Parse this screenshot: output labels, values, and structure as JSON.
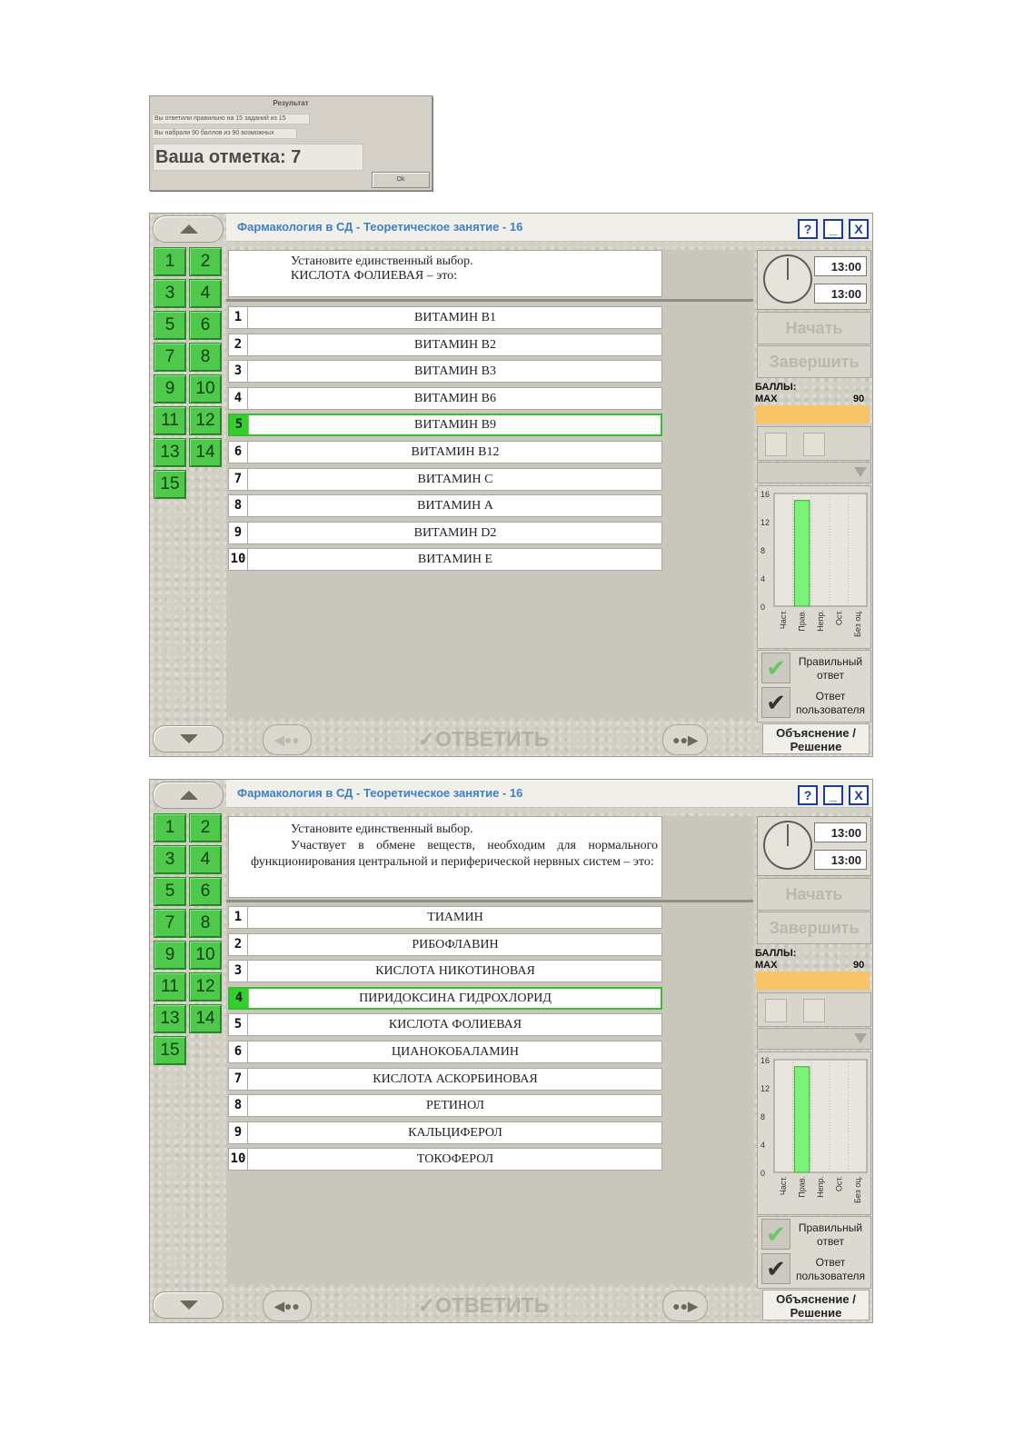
{
  "result": {
    "title": "Результат",
    "line1": "Вы ответили правильно на 15 заданий из 15",
    "line2": "Вы набрали 90 баллов из 90 возможных",
    "grade": "Ваша отметка: 7",
    "ok": "Ok"
  },
  "common": {
    "title": "Фармакология в СД - Теоретическое занятие - 16",
    "help": "?",
    "minimize": "_",
    "close": "X",
    "numbers": [
      "1",
      "2",
      "3",
      "4",
      "5",
      "6",
      "7",
      "8",
      "9",
      "10",
      "11",
      "12",
      "13",
      "14",
      "15"
    ],
    "time_total": "13:00",
    "time_left": "13:00",
    "start": "Начать",
    "finish": "Завершить",
    "score_label": "БАЛЛЫ:",
    "max_label": "MAX",
    "max_value": "90",
    "answer": "✓ОТВЕТИТЬ",
    "explanation": "Объяснение / Решение",
    "correct_answer": "Правильный ответ",
    "user_answer": "Ответ пользователя",
    "prev": "◀●●",
    "next": "●●▶",
    "icon_up": "up-arrow-icon",
    "icon_down": "down-arrow-icon",
    "icon_check": "check-icon"
  },
  "chart_data": {
    "type": "bar",
    "categories": [
      "Част.",
      "Прав.",
      "Непр.",
      "Ост.",
      "Без оц."
    ],
    "values": [
      0,
      15,
      0,
      0,
      0
    ],
    "yticks": [
      "16",
      "12",
      "8",
      "4",
      "0"
    ],
    "ylim": [
      0,
      16
    ],
    "color": "#7df27a"
  },
  "q1": {
    "instruction": "Установите единственный выбор.",
    "text": "КИСЛОТА ФОЛИЕВАЯ – это:",
    "selected": 5,
    "answers": [
      "ВИТАМИН В1",
      "ВИТАМИН В2",
      "ВИТАМИН В3",
      "ВИТАМИН В6",
      "ВИТАМИН В9",
      "ВИТАМИН В12",
      "ВИТАМИН С",
      "ВИТАМИН А",
      "ВИТАМИН D2",
      "ВИТАМИН Е"
    ]
  },
  "q2": {
    "instruction": "Установите единственный выбор.",
    "text": "Участвует в обмене веществ, необходим для нормального функционирования центральной и периферической нервных систем – это:",
    "selected": 4,
    "answers": [
      "ТИАМИН",
      "РИБОФЛАВИН",
      "КИСЛОТА НИКОТИНОВАЯ",
      "ПИРИДОКСИНА ГИДРОХЛОРИД",
      "КИСЛОТА ФОЛИЕВАЯ",
      "ЦИАНОКОБАЛАМИН",
      "КИСЛОТА АСКОРБИНОВАЯ",
      "РЕТИНОЛ",
      "КАЛЬЦИФЕРОЛ",
      "ТОКОФЕРОЛ"
    ]
  }
}
